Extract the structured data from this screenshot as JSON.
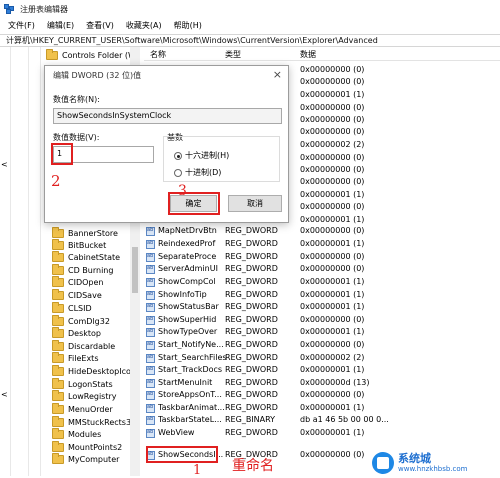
{
  "window": {
    "title": "注册表编辑器"
  },
  "menu": [
    "文件(F)",
    "编辑(E)",
    "查看(V)",
    "收藏夹(A)",
    "帮助(H)"
  ],
  "address": "计算机\\HKEY_CURRENT_USER\\Software\\Microsoft\\Windows\\CurrentVersion\\Explorer\\Advanced",
  "tree": {
    "top": "Controls Folder (W",
    "items": [
      "BannerStore",
      "BitBucket",
      "CabinetState",
      "CD Burning",
      "CIDOpen",
      "CIDSave",
      "CLSID",
      "ComDlg32",
      "Desktop",
      "Discardable",
      "FileExts",
      "HideDesktopIco",
      "LogonStats",
      "LowRegistry",
      "MenuOrder",
      "MMStuckRects3",
      "Modules",
      "MountPoints2",
      "MyComputer"
    ]
  },
  "columns": {
    "name": "名称",
    "type": "类型",
    "data": "数据"
  },
  "values_top": [
    "0x00000000 (0)",
    "0x00000000 (0)",
    "0x00000001 (1)",
    "0x00000000 (0)",
    "0x00000000 (0)",
    "0x00000000 (0)",
    "0x00000002 (2)",
    "0x00000000 (0)",
    "0x00000000 (0)",
    "0x00000000 (0)",
    "0x00000001 (1)",
    "0x00000000 (0)",
    "0x00000001 (1)"
  ],
  "values": [
    {
      "name": "MapNetDrvBtn",
      "type": "REG_DWORD",
      "data": "0x00000000 (0)"
    },
    {
      "name": "ReindexedProf",
      "type": "REG_DWORD",
      "data": "0x00000001 (1)"
    },
    {
      "name": "SeparateProce",
      "type": "REG_DWORD",
      "data": "0x00000000 (0)"
    },
    {
      "name": "ServerAdminUI",
      "type": "REG_DWORD",
      "data": "0x00000000 (0)"
    },
    {
      "name": "ShowCompCol",
      "type": "REG_DWORD",
      "data": "0x00000001 (1)"
    },
    {
      "name": "ShowInfoTip",
      "type": "REG_DWORD",
      "data": "0x00000001 (1)"
    },
    {
      "name": "ShowStatusBar",
      "type": "REG_DWORD",
      "data": "0x00000001 (1)"
    },
    {
      "name": "ShowSuperHid",
      "type": "REG_DWORD",
      "data": "0x00000000 (0)"
    },
    {
      "name": "ShowTypeOver",
      "type": "REG_DWORD",
      "data": "0x00000001 (1)"
    },
    {
      "name": "Start_NotifyNe...",
      "type": "REG_DWORD",
      "data": "0x00000000 (0)"
    },
    {
      "name": "Start_SearchFiles",
      "type": "REG_DWORD",
      "data": "0x00000002 (2)"
    },
    {
      "name": "Start_TrackDocs",
      "type": "REG_DWORD",
      "data": "0x00000001 (1)"
    },
    {
      "name": "StartMenuInit",
      "type": "REG_DWORD",
      "data": "0x0000000d (13)"
    },
    {
      "name": "StoreAppsOnT...",
      "type": "REG_DWORD",
      "data": "0x00000000 (0)"
    },
    {
      "name": "TaskbarAnimat...",
      "type": "REG_DWORD",
      "data": "0x00000001 (1)"
    },
    {
      "name": "TaskbarStateL...",
      "type": "REG_BINARY",
      "data": "db a1 46 5b 00 00 0..."
    },
    {
      "name": "WebView",
      "type": "REG_DWORD",
      "data": "0x00000001 (1)"
    },
    {
      "name": "ShowSecondsI...",
      "type": "REG_DWORD",
      "data": "0x00000000 (0)"
    }
  ],
  "dialog": {
    "title": "编辑 DWORD (32 位)值",
    "close": "×",
    "name_label": "数值名称(N):",
    "name_value": "ShowSecondsInSystemClock",
    "data_label": "数值数据(V):",
    "data_value": "1",
    "radix_label": "基数",
    "hex": "十六进制(H)",
    "dec": "十进制(D)",
    "ok": "确定",
    "cancel": "取消"
  },
  "annotations": {
    "step1": "1",
    "step2": "2",
    "step3": "3",
    "rename": "重命名"
  },
  "watermark": {
    "line1": "系统城",
    "line2": "www.hnzkhbsb.com"
  },
  "colors": {
    "annotation_red": "#e02020",
    "watermark_blue": "#1e6fd0"
  }
}
